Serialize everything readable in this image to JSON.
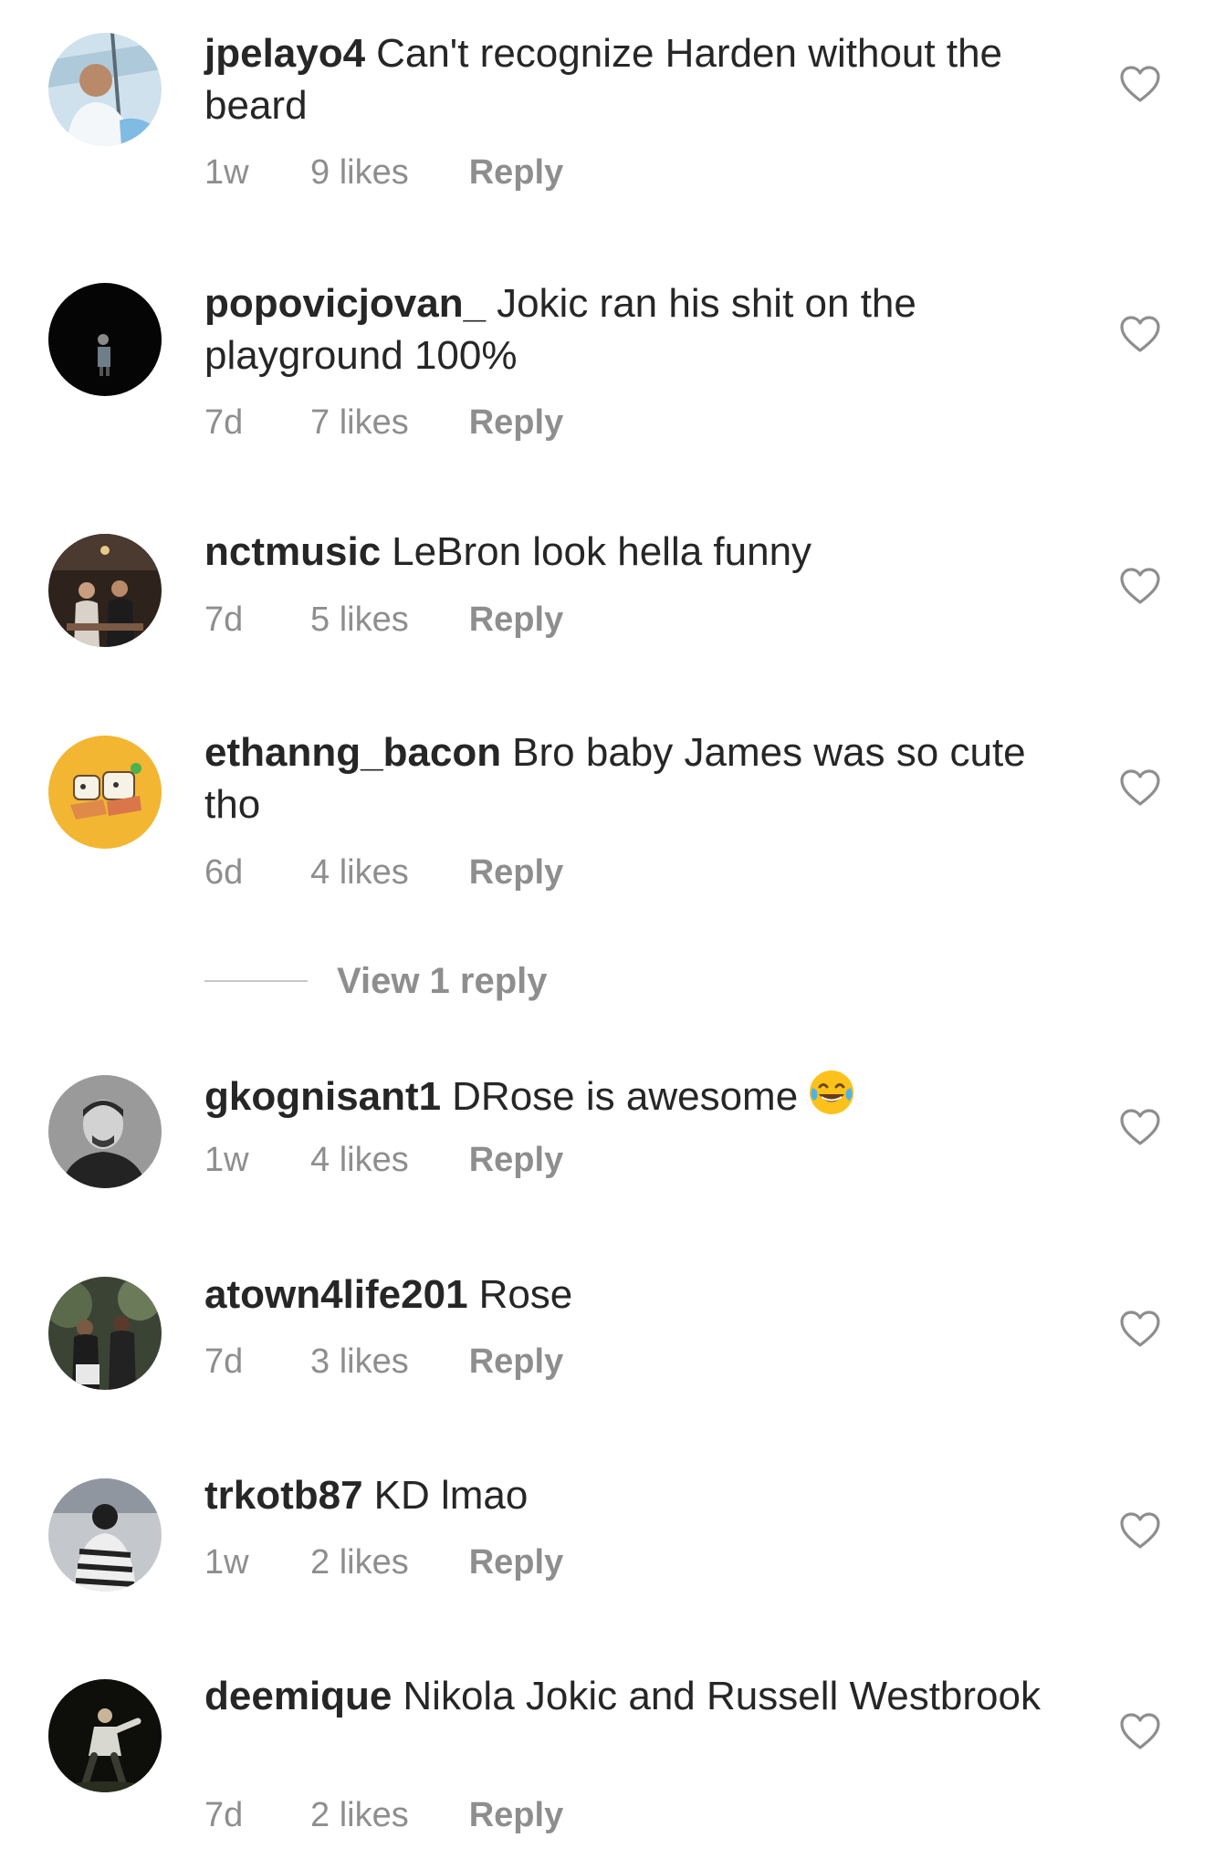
{
  "comments": [
    {
      "username": "jpelayo4",
      "text": "Can't recognize Harden without the beard",
      "time": "1w",
      "likes": "9 likes",
      "reply": "Reply",
      "avatar_color": "#9fc3da"
    },
    {
      "username": "popovicjovan_",
      "text": "Jokic ran his shit on the playground 100%",
      "time": "7d",
      "likes": "7 likes",
      "reply": "Reply",
      "avatar_color": "#0a0a0a"
    },
    {
      "username": "nctmusic",
      "text": "LeBron look hella funny",
      "time": "7d",
      "likes": "5 likes",
      "reply": "Reply",
      "avatar_color": "#3a2c25"
    },
    {
      "username": "ethanng_bacon",
      "text": "Bro baby James was so cute tho",
      "time": "6d",
      "likes": "4 likes",
      "reply": "Reply",
      "avatar_color": "#f2b632"
    },
    {
      "username": "gkognisant1",
      "text": "DRose is awesome",
      "time": "1w",
      "likes": "4 likes",
      "reply": "Reply",
      "avatar_color": "#6b6b6b"
    },
    {
      "username": "atown4life201",
      "text": "Rose",
      "time": "7d",
      "likes": "3 likes",
      "reply": "Reply",
      "avatar_color": "#2b3326"
    },
    {
      "username": "trkotb87",
      "text": "KD lmao",
      "time": "1w",
      "likes": "2 likes",
      "reply": "Reply",
      "avatar_color": "#c9ccd0"
    },
    {
      "username": "deemique",
      "text": "Nikola Jokic and Russell Westbrook",
      "time": "7d",
      "likes": "2 likes",
      "reply": "Reply",
      "avatar_color": "#14140f"
    }
  ],
  "view_replies": {
    "label": "View 1 reply"
  },
  "icons": {
    "like": "heart-outline-icon",
    "emoji": "face-with-tears-of-joy-emoji"
  },
  "colors": {
    "text": "#262626",
    "secondary": "#8e8e8e",
    "divider": "#c7c7c7"
  }
}
